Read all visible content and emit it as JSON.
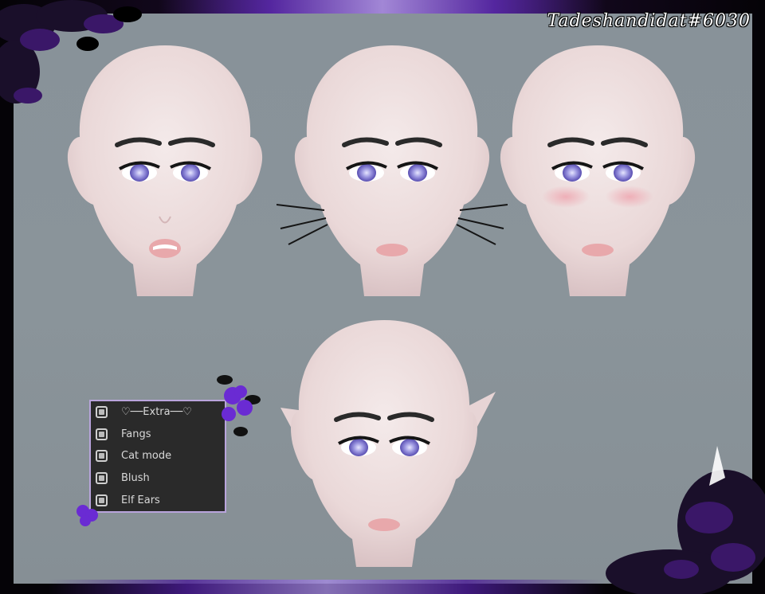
{
  "signature": "Tadeshandidat#6030",
  "colors": {
    "panel_border": "#b9a4dc",
    "accent": "#6a2bd3",
    "skin": "#f0e2e2",
    "background": "#889299"
  },
  "extras_panel": {
    "items": [
      {
        "label": "♡──Extra──♡"
      },
      {
        "label": "Fangs"
      },
      {
        "label": "Cat mode"
      },
      {
        "label": "Blush"
      },
      {
        "label": "Elf Ears"
      }
    ]
  }
}
